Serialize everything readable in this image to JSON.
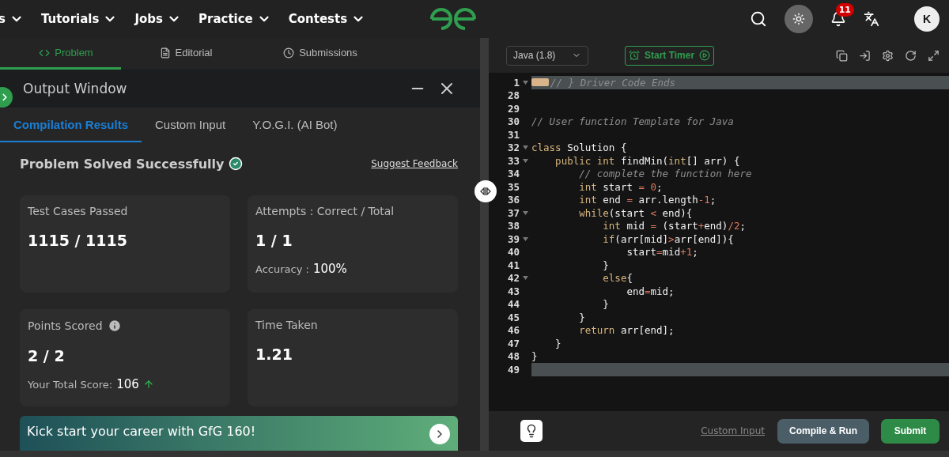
{
  "nav": {
    "items": [
      {
        "label": "s"
      },
      {
        "label": "Tutorials"
      },
      {
        "label": "Jobs"
      },
      {
        "label": "Practice"
      },
      {
        "label": "Contests"
      }
    ],
    "notification_count": "11",
    "avatar": "K"
  },
  "problem_tabs": [
    {
      "label": "Problem",
      "selected": true
    },
    {
      "label": "Editorial",
      "selected": false
    },
    {
      "label": "Submissions",
      "selected": false
    }
  ],
  "output_window": {
    "title": "Output Window",
    "tabs": [
      {
        "label": "Compilation Results",
        "selected": true
      },
      {
        "label": "Custom Input",
        "selected": false
      },
      {
        "label": "Y.O.G.I. (AI Bot)",
        "selected": false
      }
    ],
    "status": "Problem Solved Successfully",
    "feedback_link": "Suggest Feedback",
    "cards": [
      {
        "label": "Test Cases Passed",
        "value": "1115 / 1115",
        "info": false
      },
      {
        "label": "Attempts : Correct / Total",
        "value": "1 / 1",
        "info": false,
        "extra_label": "Accuracy :",
        "extra_value": "100%",
        "trend_up": false
      },
      {
        "label": "Points Scored",
        "value": "2 / 2",
        "info": true,
        "extra_label": "Your Total Score:",
        "extra_value": "106",
        "trend_up": true
      },
      {
        "label": "Time Taken",
        "value": "1.21",
        "info": false
      }
    ],
    "banner": "Kick start your career with GfG 160!"
  },
  "editor": {
    "language": "Java (1.8)",
    "timer_button": "Start Timer",
    "lines": [
      {
        "number": "1",
        "foldable": true,
        "highlighted": true,
        "folded": true,
        "tokens": [
          {
            "kind": "comment",
            "text": "// } Driver Code Ends"
          }
        ]
      },
      {
        "number": "28",
        "foldable": false,
        "highlighted": false
      },
      {
        "number": "29",
        "foldable": false,
        "highlighted": false
      },
      {
        "number": "30",
        "foldable": false,
        "highlighted": false,
        "tokens": [
          {
            "kind": "comment",
            "text": "// User function Template for Java"
          }
        ]
      },
      {
        "number": "31",
        "foldable": false,
        "highlighted": false
      },
      {
        "number": "32",
        "foldable": true,
        "highlighted": false,
        "tokens": [
          {
            "kind": "keyword",
            "text": "class"
          },
          {
            "kind": "plain",
            "text": " Solution {"
          }
        ]
      },
      {
        "number": "33",
        "foldable": true,
        "highlighted": false,
        "tokens": [
          {
            "kind": "keyword",
            "text": "    public int"
          },
          {
            "kind": "plain",
            "text": " findMin("
          },
          {
            "kind": "keyword",
            "text": "int"
          },
          {
            "kind": "plain",
            "text": "[] arr) {"
          }
        ]
      },
      {
        "number": "34",
        "foldable": false,
        "highlighted": false,
        "tokens": [
          {
            "kind": "comment",
            "text": "        // complete the function here"
          }
        ]
      },
      {
        "number": "35",
        "foldable": false,
        "highlighted": false,
        "tokens": [
          {
            "kind": "keyword",
            "text": "        int"
          },
          {
            "kind": "plain",
            "text": " start "
          },
          {
            "kind": "op",
            "text": "= 0"
          },
          {
            "kind": "plain",
            "text": ";"
          }
        ]
      },
      {
        "number": "36",
        "foldable": false,
        "highlighted": false,
        "tokens": [
          {
            "kind": "keyword",
            "text": "        int"
          },
          {
            "kind": "plain",
            "text": " end "
          },
          {
            "kind": "op",
            "text": "="
          },
          {
            "kind": "plain",
            "text": " arr.length"
          },
          {
            "kind": "op",
            "text": "-1"
          },
          {
            "kind": "plain",
            "text": ";"
          }
        ]
      },
      {
        "number": "37",
        "foldable": true,
        "highlighted": false,
        "tokens": [
          {
            "kind": "keyword",
            "text": "        while"
          },
          {
            "kind": "plain",
            "text": "(start "
          },
          {
            "kind": "op",
            "text": "<"
          },
          {
            "kind": "plain",
            "text": " end){"
          }
        ]
      },
      {
        "number": "38",
        "foldable": false,
        "highlighted": false,
        "tokens": [
          {
            "kind": "keyword",
            "text": "            int"
          },
          {
            "kind": "plain",
            "text": " mid "
          },
          {
            "kind": "op",
            "text": "="
          },
          {
            "kind": "plain",
            "text": " (start"
          },
          {
            "kind": "op",
            "text": "+"
          },
          {
            "kind": "plain",
            "text": "end)"
          },
          {
            "kind": "op",
            "text": "/2"
          },
          {
            "kind": "plain",
            "text": ";"
          }
        ]
      },
      {
        "number": "39",
        "foldable": true,
        "highlighted": false,
        "tokens": [
          {
            "kind": "keyword",
            "text": "            if"
          },
          {
            "kind": "plain",
            "text": "(arr[mid]"
          },
          {
            "kind": "op",
            "text": ">"
          },
          {
            "kind": "plain",
            "text": "arr[end]){"
          }
        ]
      },
      {
        "number": "40",
        "foldable": false,
        "highlighted": false,
        "tokens": [
          {
            "kind": "plain",
            "text": "                start"
          },
          {
            "kind": "op",
            "text": "="
          },
          {
            "kind": "plain",
            "text": "mid"
          },
          {
            "kind": "op",
            "text": "+1"
          },
          {
            "kind": "plain",
            "text": ";"
          }
        ]
      },
      {
        "number": "41",
        "foldable": false,
        "highlighted": false,
        "tokens": [
          {
            "kind": "plain",
            "text": "            }"
          }
        ]
      },
      {
        "number": "42",
        "foldable": true,
        "highlighted": false,
        "tokens": [
          {
            "kind": "keyword",
            "text": "            else"
          },
          {
            "kind": "plain",
            "text": "{"
          }
        ]
      },
      {
        "number": "43",
        "foldable": false,
        "highlighted": false,
        "tokens": [
          {
            "kind": "plain",
            "text": "                end"
          },
          {
            "kind": "op",
            "text": "="
          },
          {
            "kind": "plain",
            "text": "mid;"
          }
        ]
      },
      {
        "number": "44",
        "foldable": false,
        "highlighted": false,
        "tokens": [
          {
            "kind": "plain",
            "text": "            }"
          }
        ]
      },
      {
        "number": "45",
        "foldable": false,
        "highlighted": false,
        "tokens": [
          {
            "kind": "plain",
            "text": "        }"
          }
        ]
      },
      {
        "number": "46",
        "foldable": false,
        "highlighted": false,
        "tokens": [
          {
            "kind": "keyword",
            "text": "        return"
          },
          {
            "kind": "plain",
            "text": " arr[end];"
          }
        ]
      },
      {
        "number": "47",
        "foldable": false,
        "highlighted": false,
        "tokens": [
          {
            "kind": "plain",
            "text": "    }"
          }
        ]
      },
      {
        "number": "48",
        "foldable": false,
        "highlighted": false,
        "tokens": [
          {
            "kind": "plain",
            "text": "}"
          }
        ]
      },
      {
        "number": "49",
        "foldable": false,
        "highlighted": true
      }
    ],
    "custom_input_link": "Custom Input",
    "compile_button": "Compile & Run",
    "submit_button": "Submit"
  }
}
